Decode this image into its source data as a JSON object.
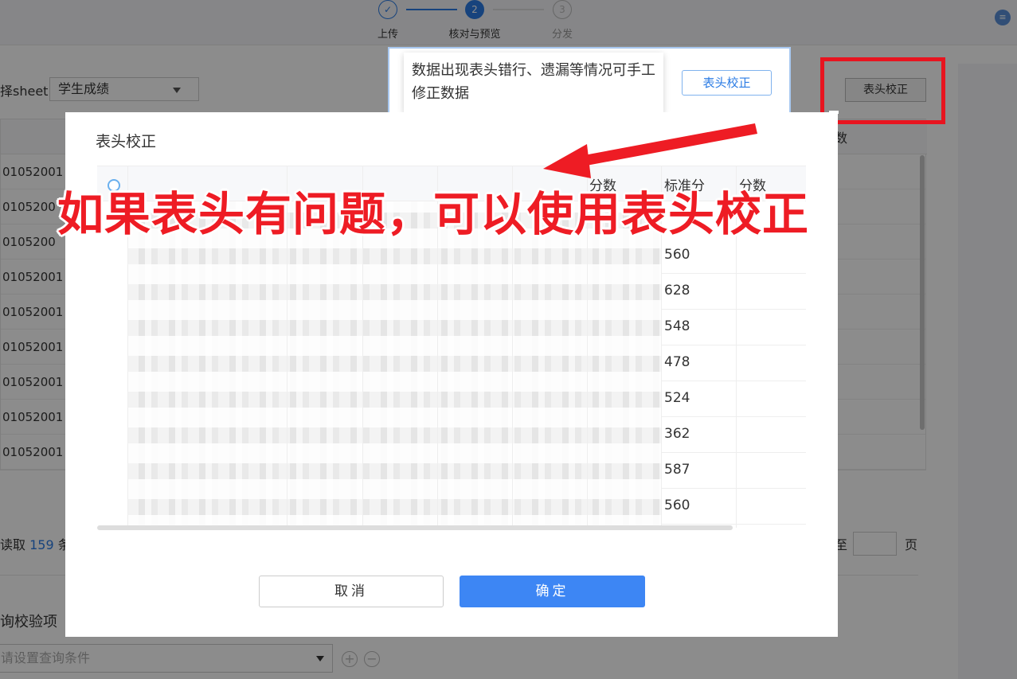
{
  "steps": [
    {
      "label": "上传",
      "symbol": "✓"
    },
    {
      "label": "核对与预览",
      "symbol": "2"
    },
    {
      "label": "分发",
      "symbol": "3"
    }
  ],
  "background": {
    "sheet_label": "择sheet:",
    "sheet_value": "学生成绩",
    "header_fix_button": "表头校正",
    "column_label": "数",
    "row_ids": [
      "01052001",
      "0105200",
      "0105200",
      "01052001",
      "01052001",
      "01052001",
      "01052001",
      "01052001",
      "01052001"
    ],
    "read_prefix": "读取",
    "read_count": "159",
    "read_suffix": "条",
    "page_to": "至",
    "page_unit": "页",
    "query_title": "询校验项",
    "query_placeholder": "请设置查询条件",
    "add_symbol": "+",
    "remove_symbol": "−"
  },
  "popover": {
    "text": "数据出现表头错行、遗漏等情况可手工修正数据",
    "button": "表头校正"
  },
  "modal": {
    "title": "表头校正",
    "headers": [
      "分数",
      "标准分",
      "分数"
    ],
    "values": [
      "560",
      "628",
      "548",
      "478",
      "524",
      "362",
      "587",
      "560"
    ],
    "cancel": "取消",
    "confirm": "确定"
  },
  "annotation": {
    "text": "如果表头有问题，可以使用表头校正"
  },
  "colors": {
    "accent": "#2a7be4",
    "primary_button": "#3d86f4",
    "annotation_red": "#ee1c24"
  }
}
